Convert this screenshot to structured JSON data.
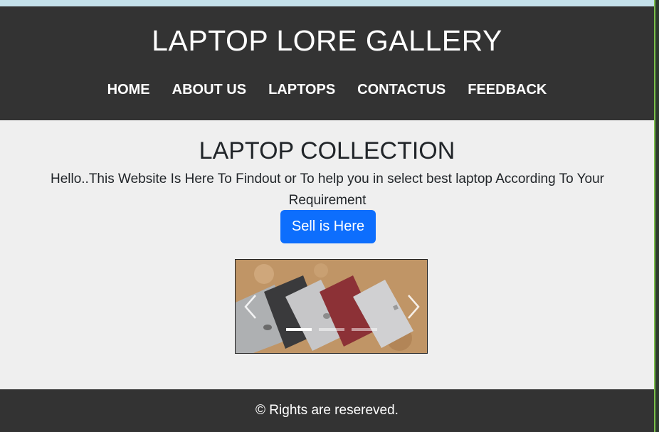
{
  "header": {
    "title": "LAPTOP LORE GALLERY",
    "nav": [
      "HOME",
      "ABOUT US",
      "LAPTOPS",
      "CONTACTUS",
      "FEEDBACK"
    ]
  },
  "main": {
    "heading": "LAPTOP COLLECTION",
    "intro": "Hello..This Website Is Here To Findout or To help you in select best laptop According To Your Requirement",
    "button_label": "Sell is Here",
    "carousel": {
      "slide_count": 3,
      "active_slide": 1
    }
  },
  "footer": {
    "text": "© Rights are resereved."
  },
  "colors": {
    "header_bg": "#333333",
    "page_bg": "#efefef",
    "button_bg": "#0d6efd",
    "top_strip": "#c4e1ea"
  }
}
